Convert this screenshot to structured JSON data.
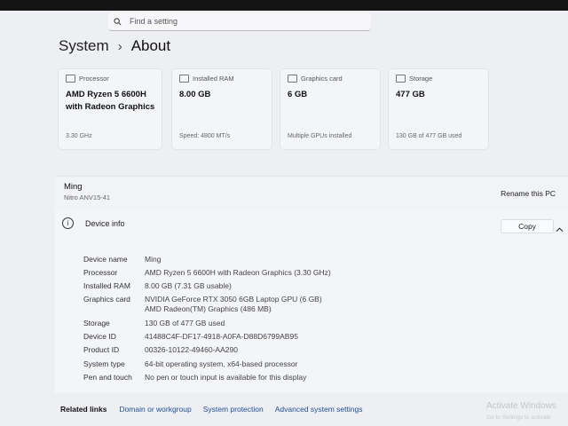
{
  "search": {
    "placeholder": "Find a setting"
  },
  "breadcrumb": {
    "parent": "System",
    "separator": "›",
    "current": "About"
  },
  "cards": [
    {
      "icon": "processor-icon",
      "label": "Processor",
      "value": "AMD Ryzen 5 6600H with Radeon Graphics",
      "sub": "3.30 GHz"
    },
    {
      "icon": "ram-icon",
      "label": "Installed RAM",
      "value": "8.00 GB",
      "sub": "Speed: 4800 MT/s"
    },
    {
      "icon": "graphics-card-icon",
      "label": "Graphics card",
      "value": "6 GB",
      "sub": "Multiple GPUs installed"
    },
    {
      "icon": "storage-icon",
      "label": "Storage",
      "value": "477 GB",
      "sub": "130 GB of 477 GB used"
    }
  ],
  "device": {
    "name": "Ming",
    "model": "Nitro ANV15-41",
    "rename_label": "Rename this PC"
  },
  "device_info": {
    "title": "Device info",
    "copy_label": "Copy",
    "rows": [
      {
        "key": "Device name",
        "value": "Ming"
      },
      {
        "key": "Processor",
        "value": "AMD Ryzen 5 6600H with Radeon Graphics (3.30 GHz)"
      },
      {
        "key": "Installed RAM",
        "value": "8.00 GB (7.31 GB usable)"
      },
      {
        "key": "Graphics card",
        "value": "NVIDIA GeForce RTX 3050 6GB Laptop GPU (6 GB)",
        "value2": "AMD Radeon(TM) Graphics (486 MB)"
      },
      {
        "key": "Storage",
        "value": "130 GB of 477 GB used"
      },
      {
        "key": "Device ID",
        "value": "41488C4F-DF17-4918-A0FA-D88D6799AB95"
      },
      {
        "key": "Product ID",
        "value": "00326-10122-49460-AA290"
      },
      {
        "key": "System type",
        "value": "64-bit operating system, x64-based processor"
      },
      {
        "key": "Pen and touch",
        "value": "No pen or touch input is available for this display"
      }
    ]
  },
  "related": {
    "label": "Related links",
    "links": [
      "Domain or workgroup",
      "System protection",
      "Advanced system settings"
    ]
  },
  "watermark": {
    "line1": "Activate Windows",
    "line2": "Go to Settings to activate"
  }
}
